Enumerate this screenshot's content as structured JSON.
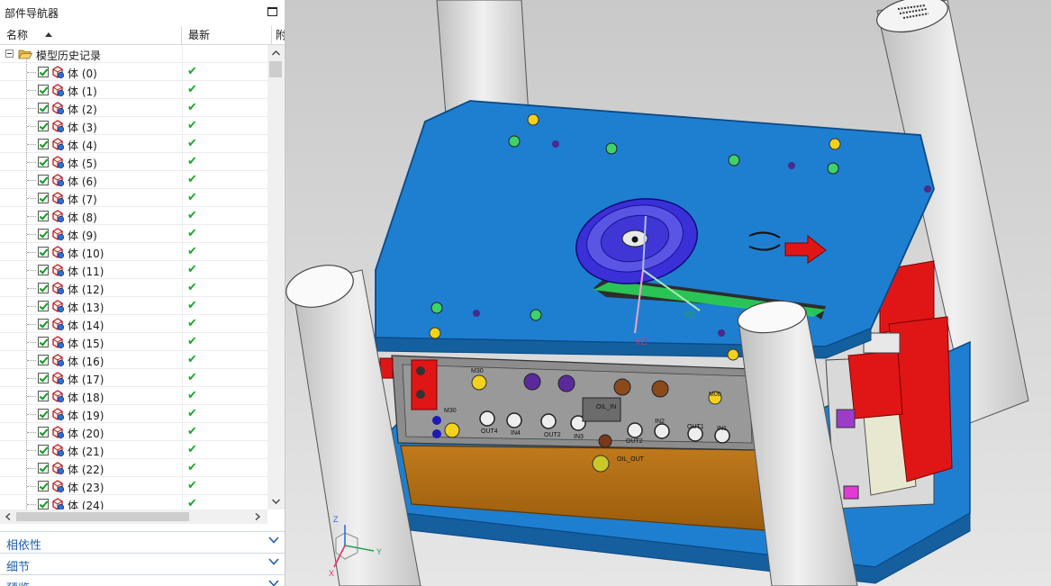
{
  "navigator": {
    "title": "部件导航器",
    "columns": {
      "name": "名称",
      "latest": "最新",
      "third": "附"
    },
    "root_label": "模型历史记录",
    "rows": [
      {
        "label": "体 (0)"
      },
      {
        "label": "体 (1)"
      },
      {
        "label": "体 (2)"
      },
      {
        "label": "体 (3)"
      },
      {
        "label": "体 (4)"
      },
      {
        "label": "体 (5)"
      },
      {
        "label": "体 (6)"
      },
      {
        "label": "体 (7)"
      },
      {
        "label": "体 (8)"
      },
      {
        "label": "体 (9)"
      },
      {
        "label": "体 (10)"
      },
      {
        "label": "体 (11)"
      },
      {
        "label": "体 (12)"
      },
      {
        "label": "体 (13)"
      },
      {
        "label": "体 (14)"
      },
      {
        "label": "体 (15)"
      },
      {
        "label": "体 (16)"
      },
      {
        "label": "体 (17)"
      },
      {
        "label": "体 (18)"
      },
      {
        "label": "体 (19)"
      },
      {
        "label": "体 (20)"
      },
      {
        "label": "体 (21)"
      },
      {
        "label": "体 (22)"
      },
      {
        "label": "体 (23)"
      },
      {
        "label": "体 (24)"
      }
    ],
    "latest_mark": "✔",
    "sections": [
      "相依性",
      "细节",
      "预览"
    ]
  },
  "viewport": {
    "labels": {
      "xc": "XC",
      "yc": "YC",
      "m30_top": "M30",
      "m30_left": "M30",
      "m00": "M00",
      "out4": "OUT4",
      "in4": "IN4",
      "out2a": "OUT2",
      "in3": "IN3",
      "out2b": "OUT2",
      "in2": "IN2",
      "out1": "OUT1",
      "in1": "IN1",
      "oil_in": "OIL_IN",
      "oil_out": "OIL_OUT"
    },
    "triad": {
      "x": "X",
      "y": "Y",
      "z": "Z"
    },
    "colors": {
      "plate": "#1e7fd0",
      "plate_edge": "#0b4a86",
      "red": "#e01616",
      "ring": "#3b2fd8"
    }
  }
}
